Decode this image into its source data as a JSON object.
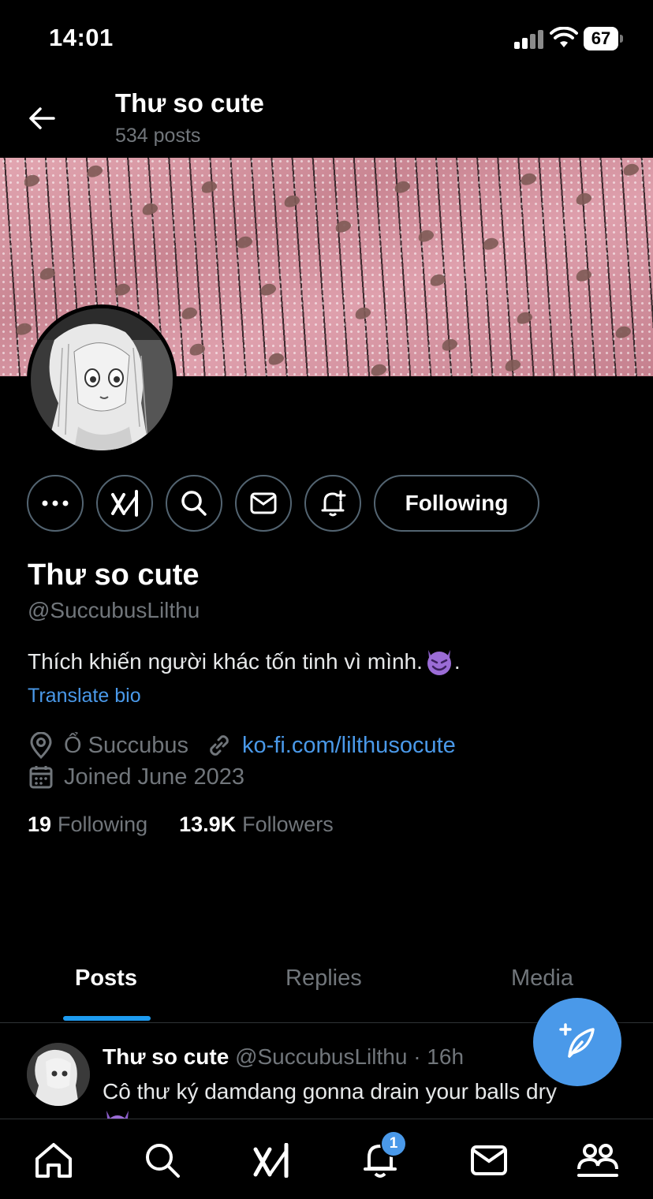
{
  "status_bar": {
    "time": "14:01",
    "battery": "67"
  },
  "header": {
    "title": "Thư so cute",
    "post_count": "534 posts"
  },
  "profile": {
    "display_name": "Thư so cute",
    "handle": "@SuccubusLilthu",
    "bio": "Thích khiến người khác tốn tinh vì mình.",
    "bio_suffix": ".",
    "translate_label": "Translate bio",
    "location": "Ổ Succubus",
    "website": "ko-fi.com/lilthusocute",
    "joined": "Joined June 2023",
    "following_count": "19",
    "following_label": "Following",
    "followers_count": "13.9K",
    "followers_label": "Followers"
  },
  "actions": {
    "following_button": "Following"
  },
  "tabs": [
    {
      "label": "Posts",
      "active": true
    },
    {
      "label": "Replies",
      "active": false
    },
    {
      "label": "Media",
      "active": false
    }
  ],
  "post": {
    "author": "Thư so cute",
    "handle": "@SuccubusLilthu",
    "separator": "·",
    "time": "16h",
    "text": "Cô thư ký damdang gonna drain your balls dry"
  },
  "nav": {
    "items": [
      "home-icon",
      "search-icon",
      "grok-icon",
      "notifications-icon",
      "messages-icon",
      "communities-icon"
    ],
    "notification_badge": "1"
  },
  "colors": {
    "accent": "#4a99e9",
    "background": "#000000",
    "muted": "#71767b"
  }
}
